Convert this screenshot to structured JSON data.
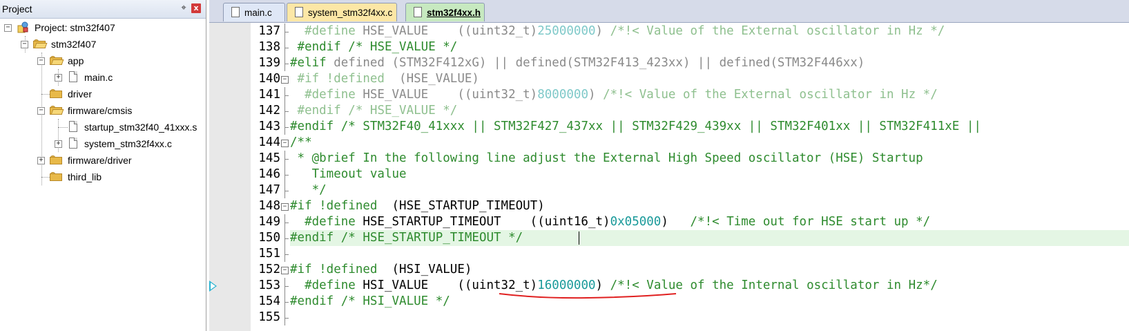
{
  "project_panel": {
    "title": "Project",
    "pin_glyph": "⌖",
    "close_glyph": "x",
    "tree": [
      {
        "label": "Project: stm32f407",
        "icon": "project-icon",
        "expander": "−",
        "level": 0
      },
      {
        "label": "stm32f407",
        "icon": "target-folder-icon",
        "expander": "−",
        "level": 1
      },
      {
        "label": "app",
        "icon": "folder-open-icon",
        "expander": "−",
        "level": 2
      },
      {
        "label": "main.c",
        "icon": "file-icon",
        "expander": "+",
        "level": 3
      },
      {
        "label": "driver",
        "icon": "folder-icon",
        "expander": "",
        "level": 2
      },
      {
        "label": "firmware/cmsis",
        "icon": "folder-open-icon",
        "expander": "−",
        "level": 2
      },
      {
        "label": "startup_stm32f40_41xxx.s",
        "icon": "file-icon",
        "expander": "",
        "level": 3
      },
      {
        "label": "system_stm32f4xx.c",
        "icon": "file-icon",
        "expander": "+",
        "level": 3
      },
      {
        "label": "firmware/driver",
        "icon": "folder-icon",
        "expander": "+",
        "level": 2
      },
      {
        "label": "third_lib",
        "icon": "folder-icon",
        "expander": "",
        "level": 2
      }
    ]
  },
  "tabs": [
    {
      "label": "main.c",
      "active": false
    },
    {
      "label": "system_stm32f4xx.c",
      "active": false
    },
    {
      "label": "stm32f4xx.h",
      "active": true
    }
  ],
  "editor": {
    "current_line": 150,
    "marker_line": 153,
    "lines": [
      {
        "num": "137",
        "segs": [
          {
            "t": "  #define ",
            "c": "pp-dim"
          },
          {
            "t": "HSE_VALUE    ",
            "c": "t-dim"
          },
          {
            "t": "((uint32_t)",
            "c": "t-dim"
          },
          {
            "t": "25000000",
            "c": "n-dim"
          },
          {
            "t": ") ",
            "c": "t-dim"
          },
          {
            "t": "/*!< Value of the External oscillator in Hz */",
            "c": "c-dim"
          }
        ]
      },
      {
        "num": "138",
        "segs": [
          {
            "t": " #endif ",
            "c": "pp"
          },
          {
            "t": "/* HSE_VALUE */",
            "c": "c"
          }
        ]
      },
      {
        "num": "139",
        "segs": [
          {
            "t": "#elif ",
            "c": "pp"
          },
          {
            "t": "defined (STM32F412xG) || defined(STM32F413_423xx) || defined(STM32F446xx)",
            "c": "t-dim"
          }
        ]
      },
      {
        "num": "140",
        "segs": [
          {
            "t": " #if !defined  ",
            "c": "pp-dim"
          },
          {
            "t": "(HSE_VALUE)",
            "c": "t-dim"
          }
        ]
      },
      {
        "num": "141",
        "segs": [
          {
            "t": "  #define ",
            "c": "pp-dim"
          },
          {
            "t": "HSE_VALUE    ((uint32_t)",
            "c": "t-dim"
          },
          {
            "t": "8000000",
            "c": "n-dim"
          },
          {
            "t": ") ",
            "c": "t-dim"
          },
          {
            "t": "/*!< Value of the External oscillator in Hz */",
            "c": "c-dim"
          }
        ]
      },
      {
        "num": "142",
        "segs": [
          {
            "t": " #endif ",
            "c": "pp-dim"
          },
          {
            "t": "/* HSE_VALUE */",
            "c": "c-dim"
          }
        ]
      },
      {
        "num": "143",
        "segs": [
          {
            "t": "#endif ",
            "c": "pp"
          },
          {
            "t": "/* STM32F40_41xxx || STM32F427_437xx || STM32F429_439xx || STM32F401xx || STM32F411xE ||",
            "c": "c"
          }
        ]
      },
      {
        "num": "144",
        "segs": [
          {
            "t": "/**",
            "c": "c"
          }
        ]
      },
      {
        "num": "145",
        "segs": [
          {
            "t": " * @brief In the following line adjust the External High Speed oscillator (HSE) Startup",
            "c": "c"
          }
        ]
      },
      {
        "num": "146",
        "segs": [
          {
            "t": "   Timeout value",
            "c": "c"
          }
        ]
      },
      {
        "num": "147",
        "segs": [
          {
            "t": "   */",
            "c": "c"
          }
        ]
      },
      {
        "num": "148",
        "segs": [
          {
            "t": "#if !defined  ",
            "c": "pp"
          },
          {
            "t": "(HSE_STARTUP_TIMEOUT)",
            "c": "t"
          }
        ]
      },
      {
        "num": "149",
        "segs": [
          {
            "t": "  #define ",
            "c": "pp"
          },
          {
            "t": "HSE_STARTUP_TIMEOUT    ((uint16_t)",
            "c": "t"
          },
          {
            "t": "0x05000",
            "c": "n"
          },
          {
            "t": ")   ",
            "c": "t"
          },
          {
            "t": "/*!< Time out for HSE start up */",
            "c": "c"
          }
        ]
      },
      {
        "num": "150",
        "segs": [
          {
            "t": "#endif ",
            "c": "pp"
          },
          {
            "t": "/* HSE_STARTUP_TIMEOUT */",
            "c": "c"
          }
        ]
      },
      {
        "num": "151",
        "segs": []
      },
      {
        "num": "152",
        "segs": [
          {
            "t": "#if !defined  ",
            "c": "pp"
          },
          {
            "t": "(HSI_VALUE)",
            "c": "t"
          }
        ]
      },
      {
        "num": "153",
        "segs": [
          {
            "t": "  #define ",
            "c": "pp"
          },
          {
            "t": "HSI_VALUE    ((uint32_t)",
            "c": "t"
          },
          {
            "t": "16000000",
            "c": "n"
          },
          {
            "t": ") ",
            "c": "t"
          },
          {
            "t": "/*!< Value of the Internal oscillator in Hz*/",
            "c": "c"
          }
        ]
      },
      {
        "num": "154",
        "segs": [
          {
            "t": "#endif ",
            "c": "pp"
          },
          {
            "t": "/* HSI_VALUE */",
            "c": "c"
          }
        ]
      },
      {
        "num": "155",
        "segs": []
      }
    ]
  },
  "colors": {
    "accent_cursor_line": "#e4f6e4",
    "annotation_underline": "#e02020",
    "marker_arrow": "#29b3d1"
  }
}
